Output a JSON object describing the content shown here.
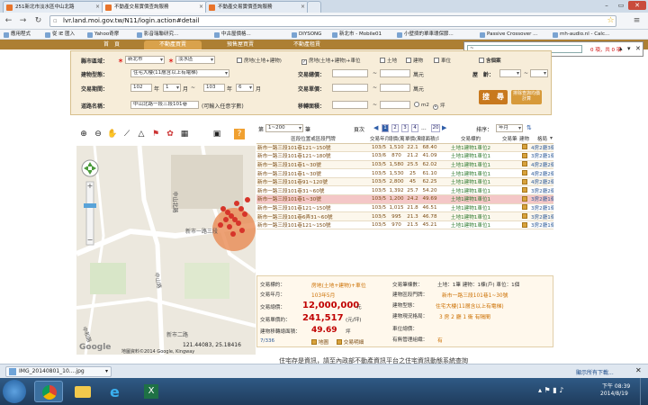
{
  "browser": {
    "tabs": [
      {
        "title": "251新北市淡水區中山北路"
      },
      {
        "title": "不動產交易實價查詢服務"
      },
      {
        "title": "不動產交易實價查詢服務"
      }
    ],
    "url": "lvr.land.moi.gov.tw/N11/login.action#detail",
    "bookmarks": [
      "應用程式",
      "從 IE 匯入",
      "Yahoo奇摩",
      "影音瑞聯研究...",
      "中古屋價格...",
      "DIYSONG",
      "新北市 - Mobile01",
      "小壁擠的單車環保節...",
      "Passive Crossover ...",
      "mh-audio.nl - Calc..."
    ]
  },
  "popup": {
    "value": "0 項，共 0 項"
  },
  "site_nav": {
    "tabs": [
      "首　頁",
      "不動產買賣",
      "預售屋買賣",
      "不動產租賃"
    ]
  },
  "search": {
    "city_label": "縣市區域：",
    "city_value": "新北市",
    "district_value": "淡水區",
    "checks": [
      {
        "label": "房地(土地+建物)",
        "checked": false
      },
      {
        "label": "房地(土地+建物)+車位",
        "checked": true
      },
      {
        "label": "土地",
        "checked": false
      },
      {
        "label": "建物",
        "checked": false
      },
      {
        "label": "車位",
        "checked": false
      }
    ],
    "all_label": "含個案",
    "building_label": "建物型態：",
    "building_value": "住宅大樓(11層含以上有電梯)",
    "total_label": "交易總價：",
    "unit_wan": "萬元",
    "age_label": "屋　齡：",
    "period_label": "交易期間：",
    "period_from_year": "102",
    "period_from_month": "1",
    "period_to_year": "103",
    "period_to_month": "6",
    "year_text": "年",
    "month_text": "月",
    "tilde": "~",
    "unitprice_label": "交易單價：",
    "road_label": "道路名稱：",
    "road_value": "中山北路一段三段101巷",
    "road_hint": "(可輸入任意字數)",
    "area_label": "移轉面積：",
    "area_unit_m2": "m2",
    "area_unit_ping": "坪",
    "search_btn": "搜　尋",
    "price_btn": "排除查詢均價計算"
  },
  "map": {
    "labels": [
      "中山北路",
      "新市一路三段",
      "中山路",
      "新市二路",
      "中和路"
    ],
    "scale_value": "121.44083, 25.18416",
    "copyright": "地圖資料©2014 Google, Kingway",
    "google": "Google",
    "tools": [
      "zoom-in-icon",
      "zoom-out-icon",
      "pan-icon",
      "measure-icon",
      "polygon-icon",
      "pin-icon",
      "layer-icon",
      "print-icon",
      "fullscreen-icon",
      "help-icon"
    ]
  },
  "paging": {
    "select_value": "1~200",
    "page_label": "第",
    "page_unit": "筆",
    "pages_label": "頁次",
    "pages": [
      "1",
      "2",
      "3",
      "4"
    ],
    "ellipsis": "...",
    "last": "20",
    "sort_label": "排序：",
    "sort_value": "年月"
  },
  "table": {
    "headers": [
      "區段位置或區段門牌",
      "交易年月",
      "總價(萬)",
      "單價(萬/坪)",
      "總面積(坪)",
      "交易標的",
      "交易筆棟數",
      "建物",
      "格局"
    ],
    "rows": [
      {
        "addr": "新市一路三段101巷121~150號",
        "ym": "103/5",
        "total": "1,510",
        "unit": "22.1",
        "area": "68.40",
        "type": "土地1建物1車位2",
        "layout": "4房2廳3衛"
      },
      {
        "addr": "新市一路三段101巷121~180號",
        "ym": "103/6",
        "total": "870",
        "unit": "21.2",
        "area": "41.09",
        "type": "土地1建物1車位1",
        "layout": "3房2廳1衛"
      },
      {
        "addr": "新市一路三段101巷1~30號",
        "ym": "103/5",
        "total": "1,580",
        "unit": "25.5",
        "area": "62.02",
        "type": "土地1建物1車位1",
        "layout": "4房2廳2衛"
      },
      {
        "addr": "新市一路三段101巷1~30號",
        "ym": "103/5",
        "total": "1,530",
        "unit": "25",
        "area": "61.10",
        "type": "土地1建物1車位1",
        "layout": "4房2廳2衛"
      },
      {
        "addr": "新市一路三段101巷91~120號",
        "ym": "103/5",
        "total": "2,800",
        "unit": "45",
        "area": "62.25",
        "type": "土地1建物1車位1",
        "layout": "4房2廳2衛"
      },
      {
        "addr": "新市一路三段101巷31~60號",
        "ym": "103/5",
        "total": "1,392",
        "unit": "25.7",
        "area": "54.20",
        "type": "土地1建物1車位1",
        "layout": "3房2廳2衛"
      },
      {
        "addr": "新市一路三段101巷1~30號",
        "ym": "103/5",
        "total": "1,200",
        "unit": "24.2",
        "area": "49.69",
        "type": "土地1建物1車位1",
        "layout": "3房2廳1衛"
      },
      {
        "addr": "新市一路三段101巷121~150號",
        "ym": "103/5",
        "total": "1,015",
        "unit": "21.8",
        "area": "46.51",
        "type": "土地1建物1車位1",
        "layout": "3房2廳1衛"
      },
      {
        "addr": "新市一路三段101巷6弄31~60號",
        "ym": "103/5",
        "total": "995",
        "unit": "21.3",
        "area": "46.78",
        "type": "土地1建物1車位1",
        "layout": "3房2廳1衛"
      },
      {
        "addr": "新市一路三段101巷121~150號",
        "ym": "103/5",
        "total": "970",
        "unit": "21.5",
        "area": "45.21",
        "type": "土地1建物1車位1",
        "layout": "3房2廳1衛"
      }
    ],
    "selected_index": 6
  },
  "detail": {
    "type_label": "交易標的：",
    "type_value": "房地(土地+建物)+車位",
    "ym_label": "交易年月：",
    "ym_value": "103年5月",
    "total_label": "交易總價：",
    "total_value": "12,000,000",
    "total_unit": "元",
    "unit_label": "交易單價約：",
    "unit_value": "241,517",
    "unit_unit": "(元/坪)",
    "area_label": "建物移轉總面積：",
    "area_value": "49.69",
    "area_unit": "坪",
    "count_label": "交易筆棟數：",
    "count_value": "土地：1筆 建物：1棟(戶) 車位：1個",
    "addr_label": "建物區段門牌：",
    "addr_value": "新市一路三段101巷1~30號",
    "btype_label": "建物型態：",
    "btype_value": "住宅大樓(11層含以上有電梯)",
    "layout_label": "建物現況格局：",
    "layout_value": "3 房 2 廳 1 衛 有隔間",
    "car_label": "車位總價：",
    "mgmt_label": "有無管理組織：",
    "mgmt_value": "有",
    "record": "7/336",
    "map_link": "地圖",
    "car_link": "交易明細"
  },
  "bottom_notice": "住宅存是資訊，請至內政部不動產資訊平台之住宅資訊動態系統查詢",
  "downloads": {
    "file": "IMG_20140801_10....jpg",
    "show_all": "顯示所有下載..."
  },
  "taskbar": {
    "time": "下午 08:39",
    "date": "2014/8/19"
  },
  "colors": {
    "nav_band": "#ad7f33",
    "panel": "#f7edd9",
    "selected_row": "#f4c7c7",
    "price_red": "#c00000"
  }
}
